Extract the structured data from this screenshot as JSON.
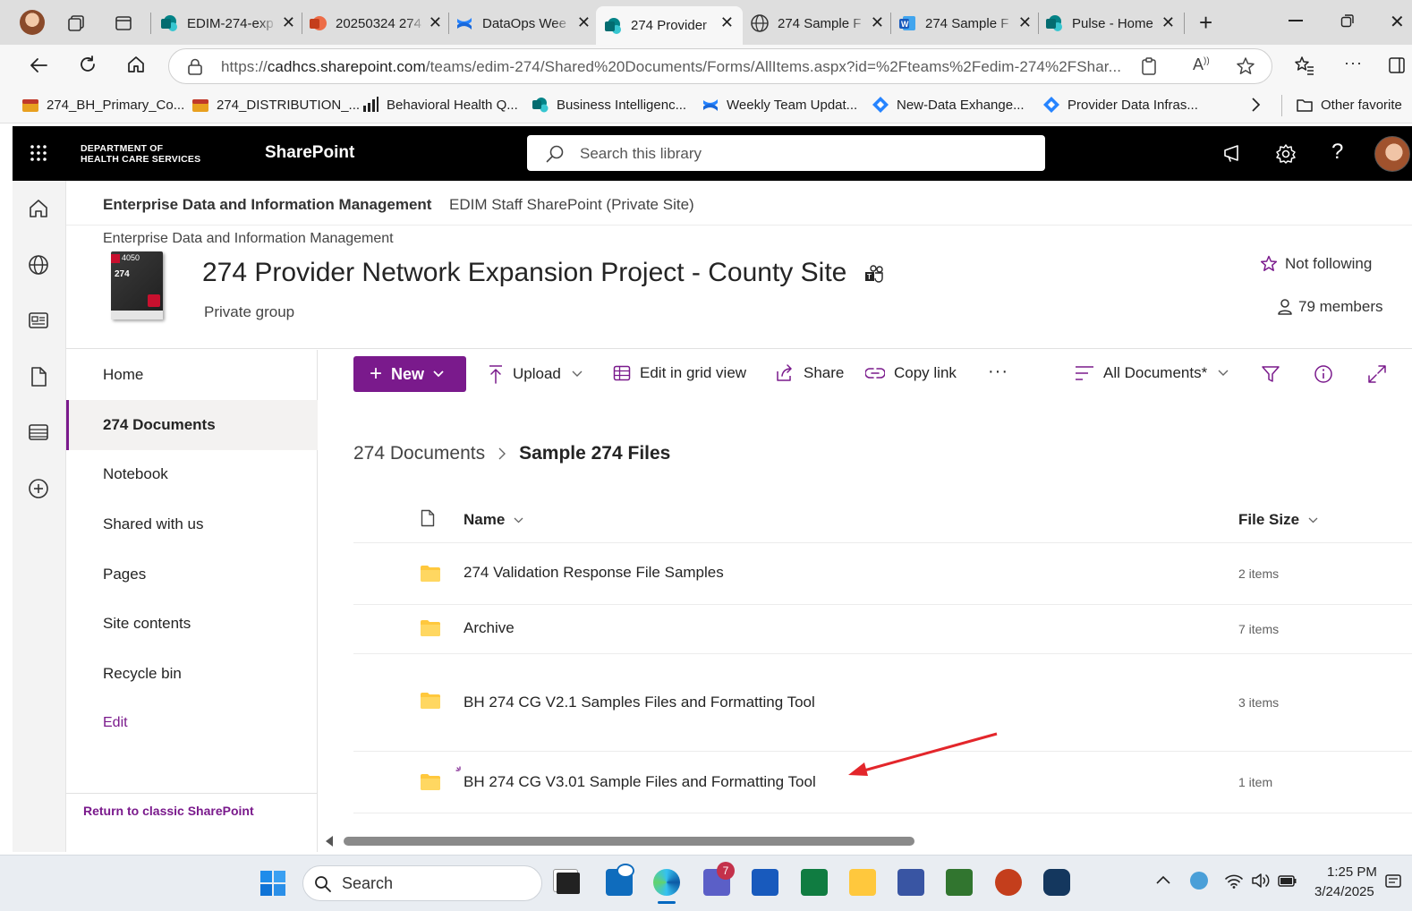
{
  "browser": {
    "tabs": [
      {
        "title": "EDIM-274-exp",
        "icon": "sharepoint-icon"
      },
      {
        "title": "20250324 274",
        "icon": "powerpoint-icon"
      },
      {
        "title": "DataOps Wee",
        "icon": "confluence-icon"
      },
      {
        "title": "274 Provider",
        "icon": "sharepoint-icon",
        "active": true
      },
      {
        "title": "274 Sample F",
        "icon": "globe-icon"
      },
      {
        "title": "274 Sample F",
        "icon": "word-icon"
      },
      {
        "title": "Pulse - Home",
        "icon": "sharepoint-icon"
      }
    ],
    "url_prefix": "https://",
    "url_host": "cadhcs.sharepoint.com",
    "url_path": "/teams/edim-274/Shared%20Documents/Forms/AllItems.aspx?id=%2Fteams%2Fedim-274%2FShar...",
    "favorites": [
      "274_BH_Primary_Co...",
      "274_DISTRIBUTION_...",
      "Behavioral Health Q...",
      "Business Intelligenc...",
      "Weekly Team Updat...",
      "New-Data Exhange...",
      "Provider Data Infras..."
    ],
    "other_favorites": "Other favorite"
  },
  "suite": {
    "org_line1": "DEPARTMENT OF",
    "org_line2": "HEALTH CARE SERVICES",
    "app_name": "SharePoint",
    "search_placeholder": "Search this library"
  },
  "hub": {
    "hub_name": "Enterprise Data and Information Management",
    "hub_link": "EDIM Staff SharePoint (Private Site)"
  },
  "site": {
    "parent": "Enterprise Data and Information Management",
    "title": "274 Provider Network Expansion Project - County Site",
    "subtitle": "Private group",
    "follow": "Not following",
    "members": "79 members",
    "logo_text": "4050",
    "logo_num": "274"
  },
  "leftnav": {
    "items": [
      "Home",
      "274 Documents",
      "Notebook",
      "Shared with us",
      "Pages",
      "Site contents",
      "Recycle bin"
    ],
    "edit": "Edit",
    "return_classic": "Return to classic SharePoint"
  },
  "commands": {
    "new": "New",
    "upload": "Upload",
    "edit_grid": "Edit in grid view",
    "share": "Share",
    "copy_link": "Copy link",
    "view": "All Documents*"
  },
  "library": {
    "breadcrumb_root": "274 Documents",
    "breadcrumb_current": "Sample 274 Files",
    "col_name": "Name",
    "col_size": "File Size",
    "rows": [
      {
        "name": "274 Validation Response File Samples",
        "size": "2 items"
      },
      {
        "name": "Archive",
        "size": "7 items"
      },
      {
        "name": "BH 274 CG V2.1 Samples Files and Formatting Tool",
        "size": "3 items"
      },
      {
        "name": "BH 274 CG V3.01 Sample Files and Formatting Tool",
        "size": "1 item"
      }
    ]
  },
  "taskbar": {
    "search": "Search",
    "time": "1:25 PM",
    "date": "3/24/2025",
    "teams_badge": "7"
  },
  "colors": {
    "accent": "#7a1a8c",
    "annotation_arrow": "#e3262b",
    "folder": "#ffc83d"
  }
}
